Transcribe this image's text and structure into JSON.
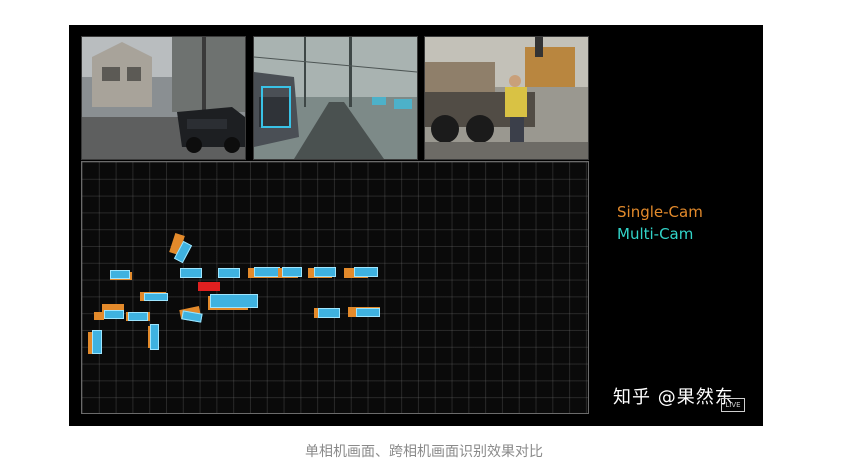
{
  "legend": {
    "single_cam": "Single-Cam",
    "multi_cam": "Multi-Cam",
    "single_color": "#e38a2b",
    "multi_color": "#32d4c9"
  },
  "watermark": "知乎 @果然东",
  "badge": "LIVE",
  "caption": "单相机画面、跨相机画面识别效果对比",
  "colors": {
    "background": "#000000",
    "orange_box": "#e38a2b",
    "cyan_box": "#3fb2e0",
    "red_box": "#e02020"
  }
}
